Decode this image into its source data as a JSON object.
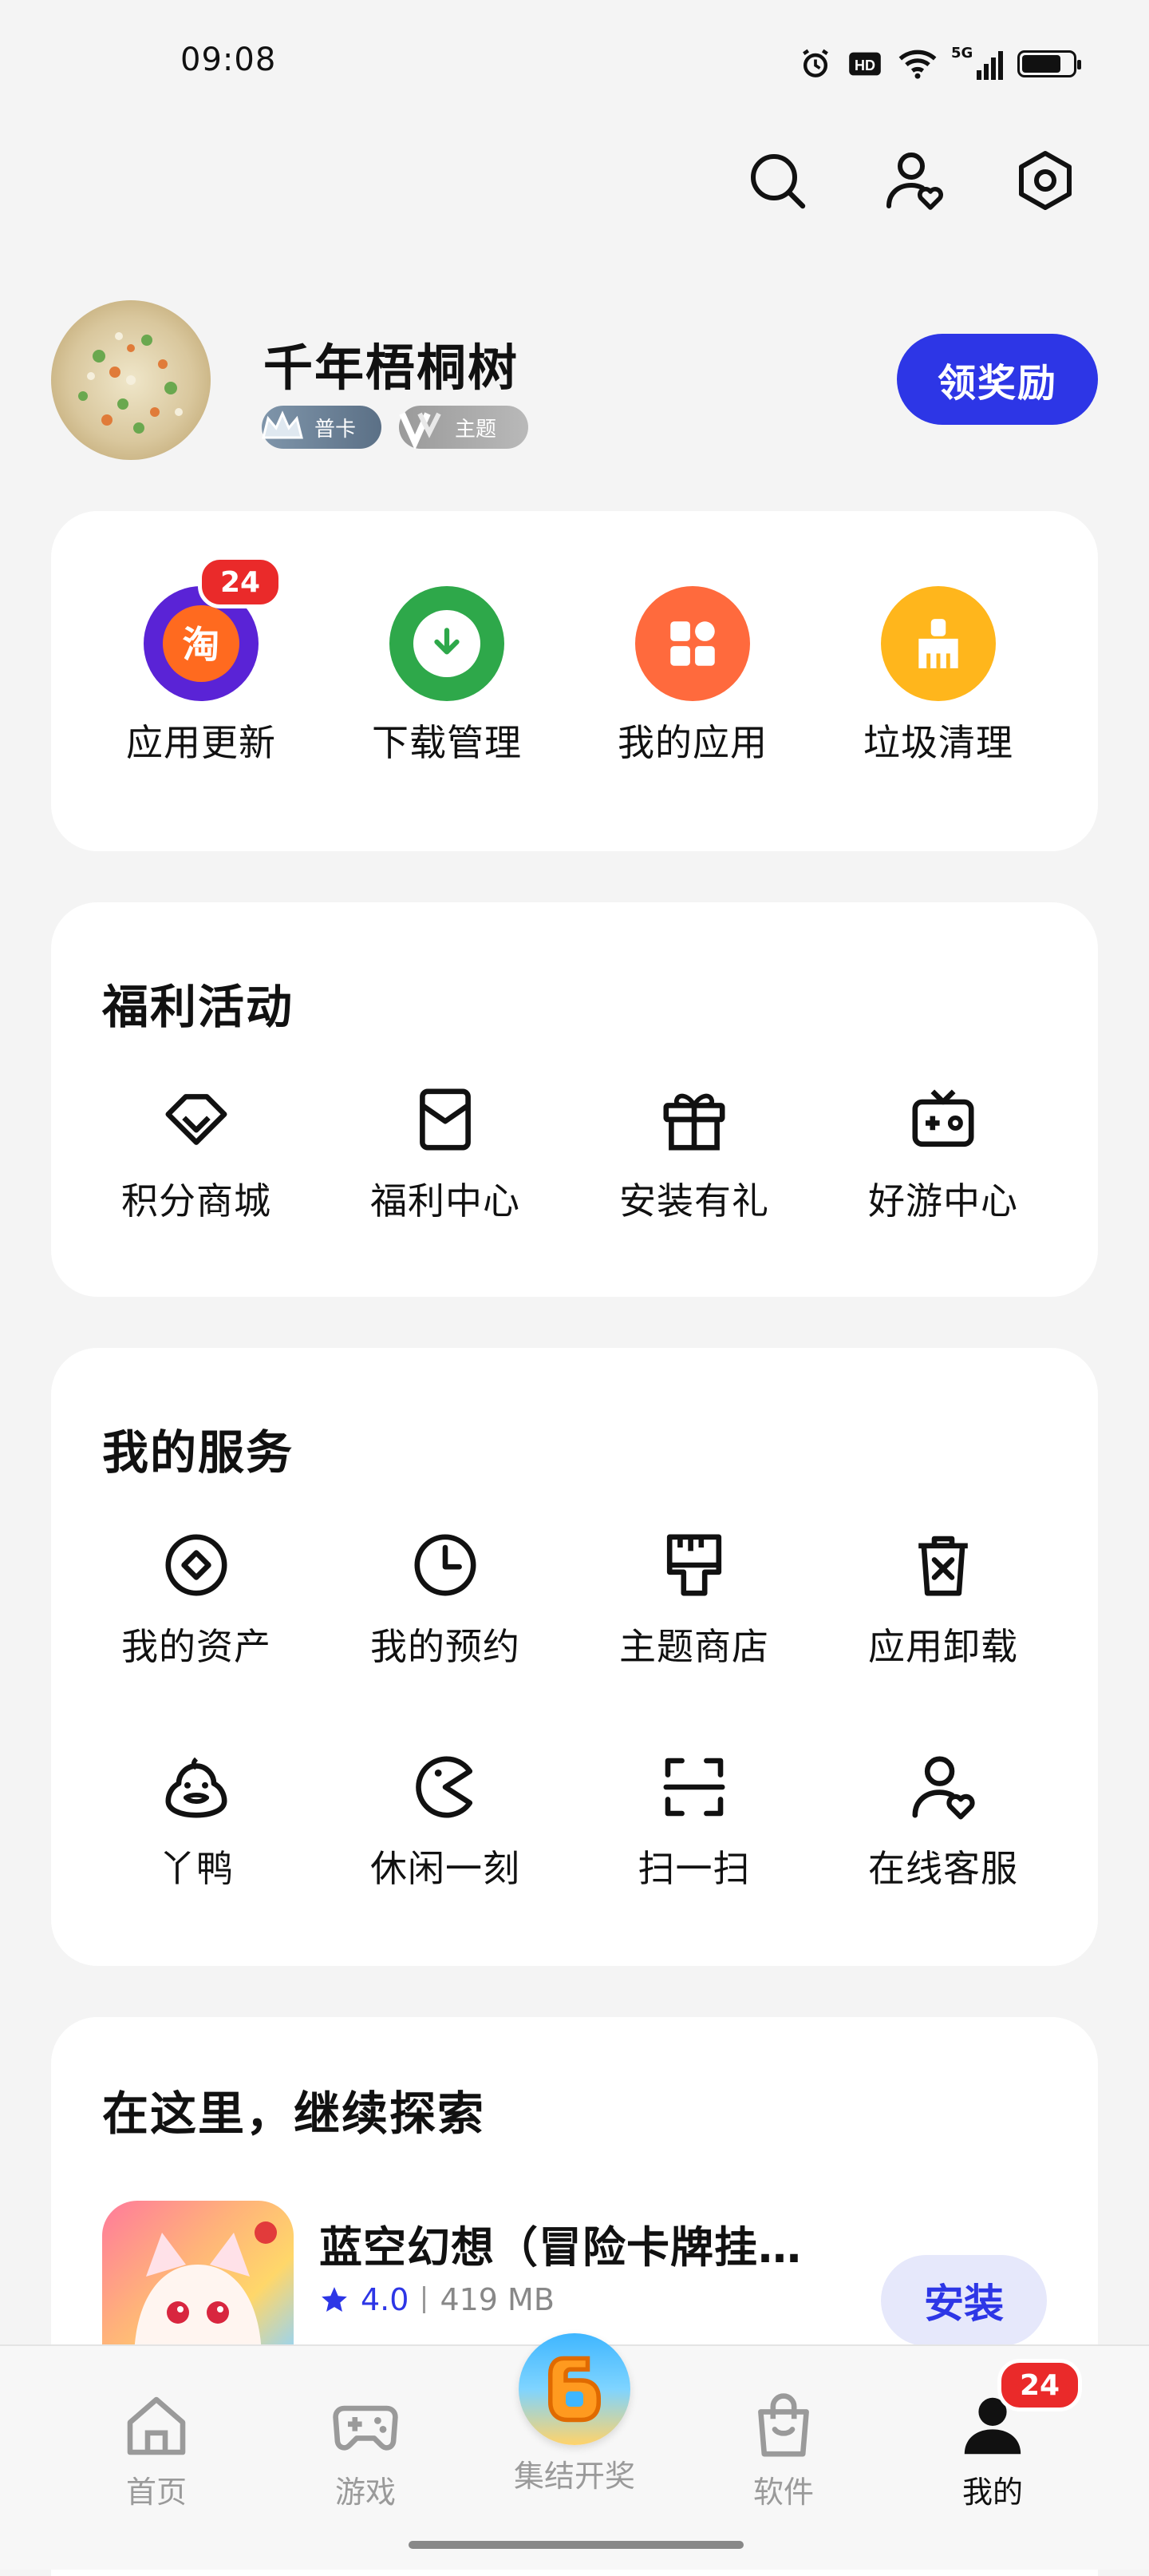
{
  "status_bar": {
    "time": "09:08",
    "network": "5G"
  },
  "header": {
    "icons": [
      "search-icon",
      "user-heart-icon",
      "settings-hex-icon"
    ]
  },
  "profile": {
    "username": "千年梧桐树",
    "badges": [
      "普卡",
      "主题"
    ],
    "reward_button": "领奖励"
  },
  "quick_actions": [
    {
      "label": "应用更新",
      "color": "#5a23d6",
      "badge": "24",
      "icon": "taobao-app-icon"
    },
    {
      "label": "下载管理",
      "color": "#2ea84a",
      "icon": "download-arrow-icon"
    },
    {
      "label": "我的应用",
      "color": "#ff6a3d",
      "icon": "app-grid-icon"
    },
    {
      "label": "垃圾清理",
      "color": "#ffb61c",
      "icon": "broom-icon"
    }
  ],
  "benefits": {
    "title": "福利活动",
    "items": [
      {
        "label": "积分商城",
        "icon": "diamond-icon"
      },
      {
        "label": "福利中心",
        "icon": "envelope-icon"
      },
      {
        "label": "安装有礼",
        "icon": "gift-icon"
      },
      {
        "label": "好游中心",
        "icon": "tv-gamepad-icon"
      }
    ]
  },
  "services": {
    "title": "我的服务",
    "items": [
      {
        "label": "我的资产",
        "icon": "assets-icon"
      },
      {
        "label": "我的预约",
        "icon": "clock-icon"
      },
      {
        "label": "主题商店",
        "icon": "paint-brush-icon"
      },
      {
        "label": "应用卸载",
        "icon": "trash-icon"
      },
      {
        "label": "丫鸭",
        "icon": "duck-icon"
      },
      {
        "label": "休闲一刻",
        "icon": "pacman-icon"
      },
      {
        "label": "扫一扫",
        "icon": "scan-icon"
      },
      {
        "label": "在线客服",
        "icon": "user-heart-icon"
      }
    ]
  },
  "explore": {
    "title": "在这里，继续探索",
    "app": {
      "name": "蓝空幻想（冒险卡牌挂…",
      "rating": "4.0",
      "size": "419 MB",
      "install_label": "安装"
    }
  },
  "bottom_nav": [
    {
      "label": "首页",
      "icon": "home-icon"
    },
    {
      "label": "游戏",
      "icon": "gamepad-icon"
    },
    {
      "label": "集结开奖",
      "icon": "event-6-icon"
    },
    {
      "label": "软件",
      "icon": "shopping-bag-icon"
    },
    {
      "label": "我的",
      "icon": "person-icon",
      "active": true,
      "badge": "24"
    }
  ],
  "colors": {
    "accent": "#2d36e6",
    "badge_red": "#ea2a2a",
    "background": "#f4f4f4"
  }
}
